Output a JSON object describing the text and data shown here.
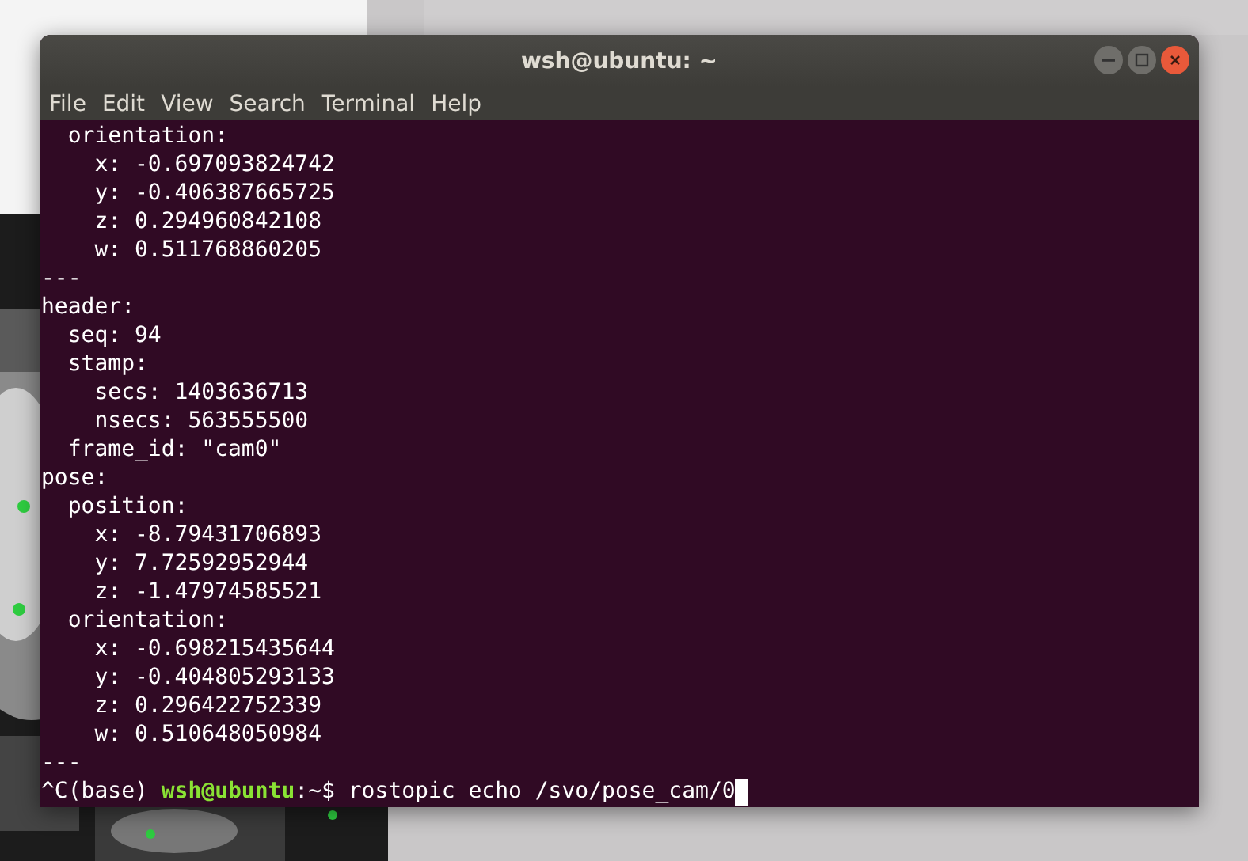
{
  "window": {
    "title": "wsh@ubuntu: ~"
  },
  "menu": [
    "File",
    "Edit",
    "View",
    "Search",
    "Terminal",
    "Help"
  ],
  "terminal": {
    "lines": [
      "  orientation:",
      "    x: -0.697093824742",
      "    y: -0.406387665725",
      "    z: 0.294960842108",
      "    w: 0.511768860205",
      "---",
      "header:",
      "  seq: 94",
      "  stamp:",
      "    secs: 1403636713",
      "    nsecs: 563555500",
      "  frame_id: \"cam0\"",
      "pose:",
      "  position:",
      "    x: -8.79431706893",
      "    y: 7.72592952944",
      "    z: -1.47974585521",
      "  orientation:",
      "    x: -0.698215435644",
      "    y: -0.404805293133",
      "    z: 0.296422752339",
      "    w: 0.510648050984",
      "---"
    ],
    "prompt": [
      {
        "kind": "plain",
        "text": "^C(base) "
      },
      {
        "kind": "user",
        "text": "wsh@ubuntu"
      },
      {
        "kind": "plain",
        "text": ":~$ rostopic echo /svo/pose_cam/0"
      }
    ]
  }
}
